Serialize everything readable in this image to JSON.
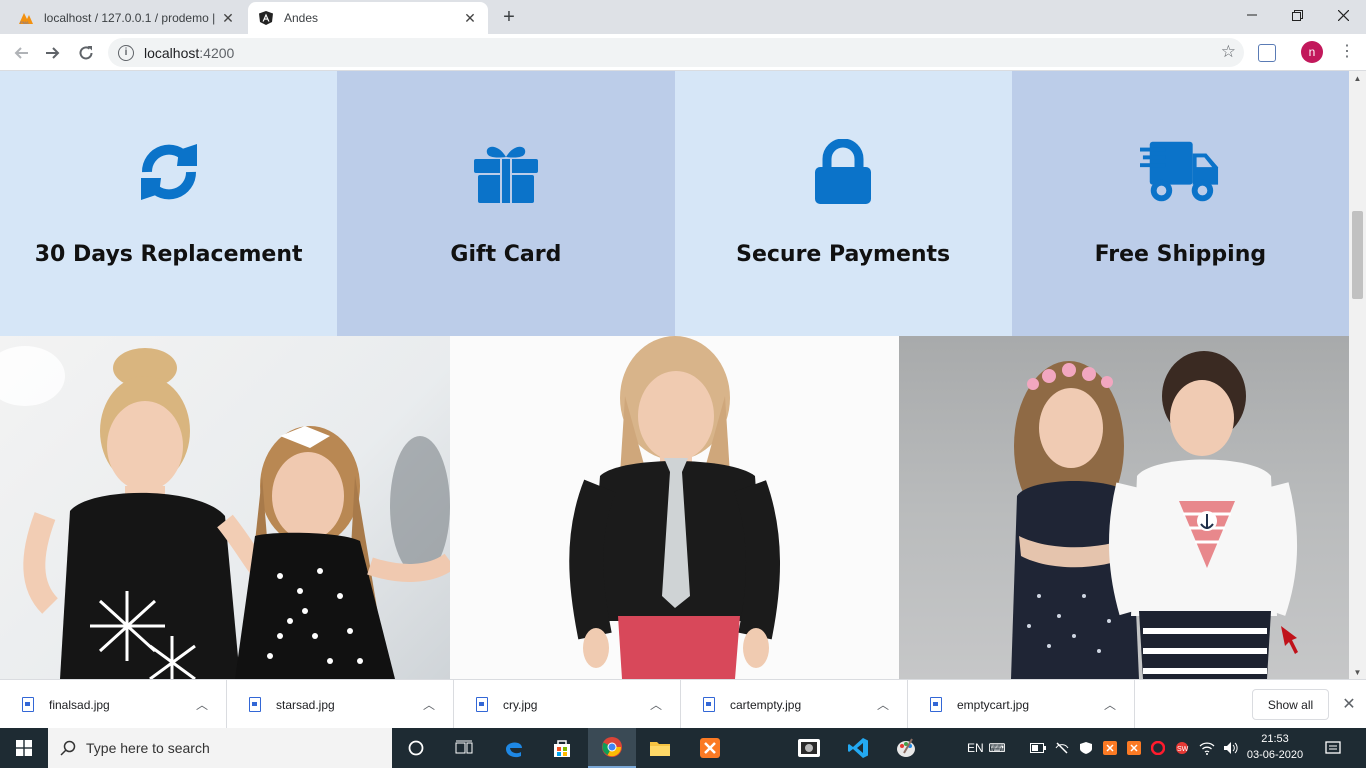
{
  "browser": {
    "tabs": [
      {
        "title": "localhost / 127.0.0.1 / prodemo |",
        "favicon": "phpmyadmin-icon"
      },
      {
        "title": "Andes",
        "favicon": "angular-icon"
      }
    ],
    "url_host": "localhost",
    "url_port": ":4200",
    "profile_initial": "n"
  },
  "features": [
    {
      "label": "30 Days Replacement",
      "icon": "sync-icon"
    },
    {
      "label": "Gift Card",
      "icon": "gift-icon"
    },
    {
      "label": "Secure Payments",
      "icon": "lock-icon"
    },
    {
      "label": "Free Shipping",
      "icon": "truck-icon"
    }
  ],
  "colors": {
    "accent": "#0b73c9",
    "feature_light": "#d6e6f7",
    "feature_dark": "#bccde9"
  },
  "downloads": [
    {
      "name": "finalsad.jpg"
    },
    {
      "name": "starsad.jpg"
    },
    {
      "name": "cry.jpg"
    },
    {
      "name": "cartempty.jpg"
    },
    {
      "name": "emptycart.jpg"
    }
  ],
  "download_shelf": {
    "show_all": "Show all"
  },
  "taskbar": {
    "search_placeholder": "Type here to search",
    "language": "EN",
    "time": "21:53",
    "date": "03-06-2020"
  }
}
